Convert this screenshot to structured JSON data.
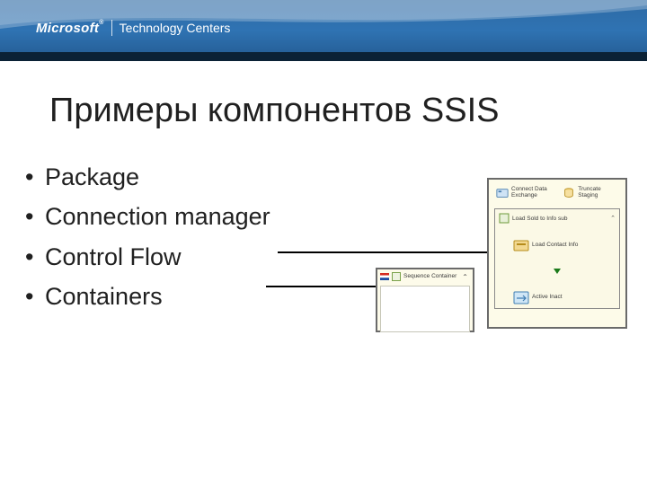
{
  "banner": {
    "brand": "Microsoft",
    "sublabel": "Technology Centers"
  },
  "title": "Примеры компонентов SSIS",
  "bullets": [
    "Package",
    "Connection manager",
    "Control Flow",
    "Containers"
  ],
  "right_panel": {
    "top_left": "Connect Data Exchange",
    "top_right": "Truncate Staging",
    "container_title": "Load Sold to Info sub",
    "inner_top": "Load Contact Info",
    "inner_bottom": "Active Inact"
  },
  "left_panel": {
    "header": "Sequence Container"
  }
}
